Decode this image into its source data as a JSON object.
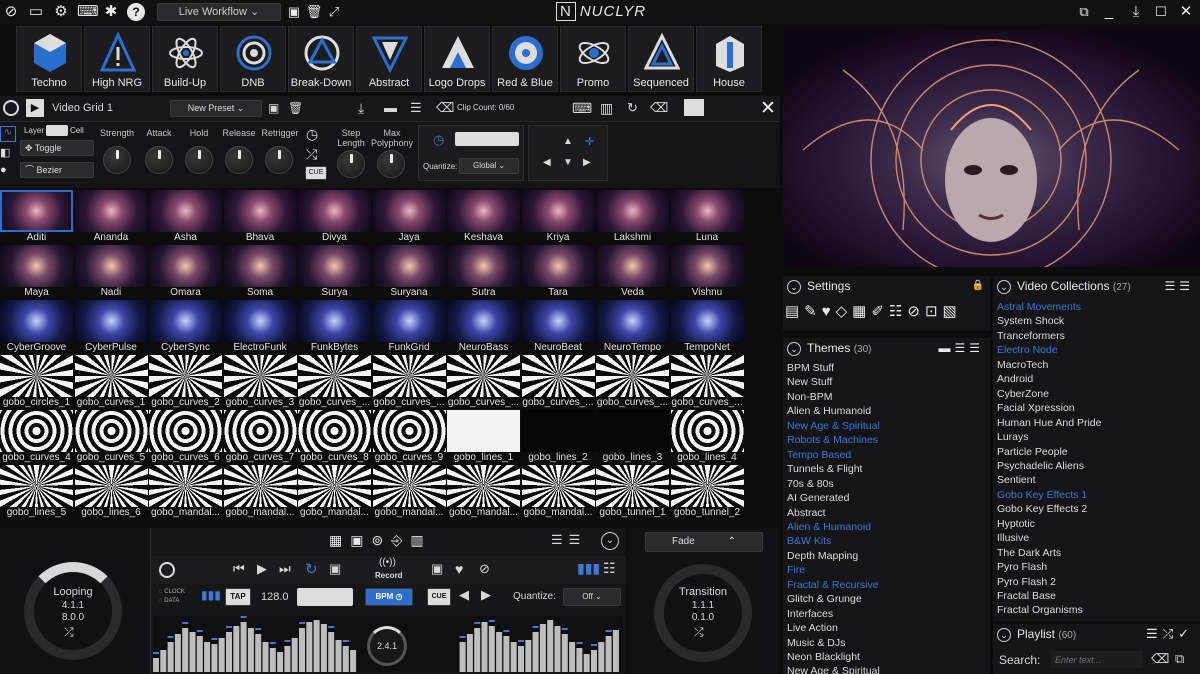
{
  "topbar": {
    "workflow": "Live Workflow",
    "logo_text": "NUCLYR"
  },
  "presets": [
    {
      "label": "Techno",
      "icon": "hexagon-cube-icon"
    },
    {
      "label": "High NRG",
      "icon": "warning-triangle-icon"
    },
    {
      "label": "Build-Up",
      "icon": "atom-icon"
    },
    {
      "label": "DNB",
      "icon": "target-rings-icon"
    },
    {
      "label": "Break-Down",
      "icon": "radiation-icon"
    },
    {
      "label": "Abstract",
      "icon": "triangle-down-icon"
    },
    {
      "label": "Logo Drops",
      "icon": "triforce-icon"
    },
    {
      "label": "Red & Blue",
      "icon": "disc-icon"
    },
    {
      "label": "Promo",
      "icon": "atom-ring-icon"
    },
    {
      "label": "Sequenced",
      "icon": "triangle-outline-icon"
    },
    {
      "label": "House",
      "icon": "block-one-icon"
    }
  ],
  "video_grid": {
    "title": "Video Grid 1",
    "preset": "New Preset",
    "clip_count_label": "Clip Count:",
    "clip_count": "0/60"
  },
  "params": {
    "layer": "Layer",
    "cell": "Cell",
    "toggle": "Toggle",
    "bezier": "Bezier",
    "strength": "Strength",
    "attack": "Attack",
    "hold": "Hold",
    "release": "Release",
    "retrigger": "Retrigger",
    "step_length": "Step\nLength",
    "max_polyphony": "Max\nPolyphony",
    "cue": "CUE",
    "quantize": "Quantize:",
    "quantize_value": "Global"
  },
  "clips": [
    [
      "Aditi",
      "Ananda",
      "Asha",
      "Bhava",
      "Divya",
      "Jaya",
      "Keshava",
      "Kriya",
      "Lakshmi",
      "Luna"
    ],
    [
      "Maya",
      "Nadi",
      "Omara",
      "Soma",
      "Surya",
      "Suryana",
      "Sutra",
      "Tara",
      "Veda",
      "Vishnu"
    ],
    [
      "CyberGroove",
      "CyberPulse",
      "CyberSync",
      "ElectroFunk",
      "FunkBytes",
      "FunkGrid",
      "NeuroBass",
      "NeuroBeat",
      "NeuroTempo",
      "TempoNet"
    ],
    [
      "gobo_circles_1",
      "gobo_curves_1",
      "gobo_curves_2",
      "gobo_curves_3",
      "gobo_curves_...",
      "gobo_curves_...",
      "gobo_curves_...",
      "gobo_curves_...",
      "gobo_curves_...",
      "gobo_curves_..."
    ],
    [
      "gobo_curves_4",
      "gobo_curves_5",
      "gobo_curves_6",
      "gobo_curves_7",
      "gobo_curves_8",
      "gobo_curves_9",
      "gobo_lines_1",
      "gobo_lines_2",
      "gobo_lines_3",
      "gobo_lines_4"
    ],
    [
      "gobo_lines_5",
      "gobo_lines_6",
      "gobo_mandal...",
      "gobo_mandal...",
      "gobo_mandal...",
      "gobo_mandal...",
      "gobo_mandal...",
      "gobo_mandal...",
      "gobo_tunnel_1",
      "gobo_tunnel_2"
    ]
  ],
  "settings": {
    "title": "Settings"
  },
  "themes": {
    "title": "Themes",
    "count": "(30)",
    "items": [
      {
        "label": "BPM Stuff",
        "hl": false
      },
      {
        "label": "New Stuff",
        "hl": false
      },
      {
        "label": "Non-BPM",
        "hl": false
      },
      {
        "label": "Alien & Humanoid",
        "hl": false
      },
      {
        "label": "New Age & Spiritual",
        "hl": true
      },
      {
        "label": "Robots & Machines",
        "hl": true
      },
      {
        "label": "Tempo Based",
        "hl": true
      },
      {
        "label": "Tunnels & Flight",
        "hl": false
      },
      {
        "label": "70s & 80s",
        "hl": false
      },
      {
        "label": "AI Generated",
        "hl": false
      },
      {
        "label": "Abstract",
        "hl": false
      },
      {
        "label": "Alien & Humanoid",
        "hl": true
      },
      {
        "label": "B&W Kits",
        "hl": true
      },
      {
        "label": "Depth Mapping",
        "hl": false
      },
      {
        "label": "Fire",
        "hl": true
      },
      {
        "label": "Fractal & Recursive",
        "hl": true
      },
      {
        "label": "Glitch & Grunge",
        "hl": false
      },
      {
        "label": "Interfaces",
        "hl": false
      },
      {
        "label": "Live Action",
        "hl": false
      },
      {
        "label": "Music & DJs",
        "hl": false
      },
      {
        "label": "Neon Blacklight",
        "hl": false
      },
      {
        "label": "New Age & Spiritual",
        "hl": false
      }
    ]
  },
  "collections": {
    "title": "Video Collections",
    "count": "(27)",
    "items": [
      {
        "label": "Astral Movements",
        "hl": true
      },
      {
        "label": "System Shock",
        "hl": false
      },
      {
        "label": "Tranceformers",
        "hl": false
      },
      {
        "label": "Electro Node",
        "hl": true
      },
      {
        "label": "MacroTech",
        "hl": false
      },
      {
        "label": "Android",
        "hl": false
      },
      {
        "label": "CyberZone",
        "hl": false
      },
      {
        "label": "Facial Xpression",
        "hl": false
      },
      {
        "label": "Human Hue And Pride",
        "hl": false
      },
      {
        "label": "Lurays",
        "hl": false
      },
      {
        "label": "Particle People",
        "hl": false
      },
      {
        "label": "Psychadelic Aliens",
        "hl": false
      },
      {
        "label": "Sentient",
        "hl": false
      },
      {
        "label": "Gobo Key Effects 1",
        "hl": true
      },
      {
        "label": "Gobo Key Effects 2",
        "hl": false
      },
      {
        "label": "Hyptotic",
        "hl": false
      },
      {
        "label": "Illusive",
        "hl": false
      },
      {
        "label": "The Dark Arts",
        "hl": false
      },
      {
        "label": "Pyro Flash",
        "hl": false
      },
      {
        "label": "Pyro Flash 2",
        "hl": false
      },
      {
        "label": "Fractal Base",
        "hl": false
      },
      {
        "label": "Fractal Organisms",
        "hl": false
      }
    ]
  },
  "playlist": {
    "title": "Playlist",
    "count": "(60)",
    "search_label": "Search:",
    "search_placeholder": "Enter text..."
  },
  "transport": {
    "looping": "Looping",
    "loop_pos": "4.1.1",
    "loop_len": "8.0.0",
    "record": "Record",
    "clock": "CLOCK",
    "data": "DATA",
    "tap": "TAP",
    "bpm_value": "128.0",
    "bpm": "BPM",
    "cue": "CUE",
    "quantize": "Quantize:",
    "quantize_value": "Off",
    "beat_pos": "2.4.1",
    "fade": "Fade",
    "transition": "Transition",
    "trans_pos": "1.1.1",
    "trans_len": "0.1.0"
  },
  "colors": {
    "accent": "#3a79d8",
    "bg": "#0c0c0d"
  }
}
